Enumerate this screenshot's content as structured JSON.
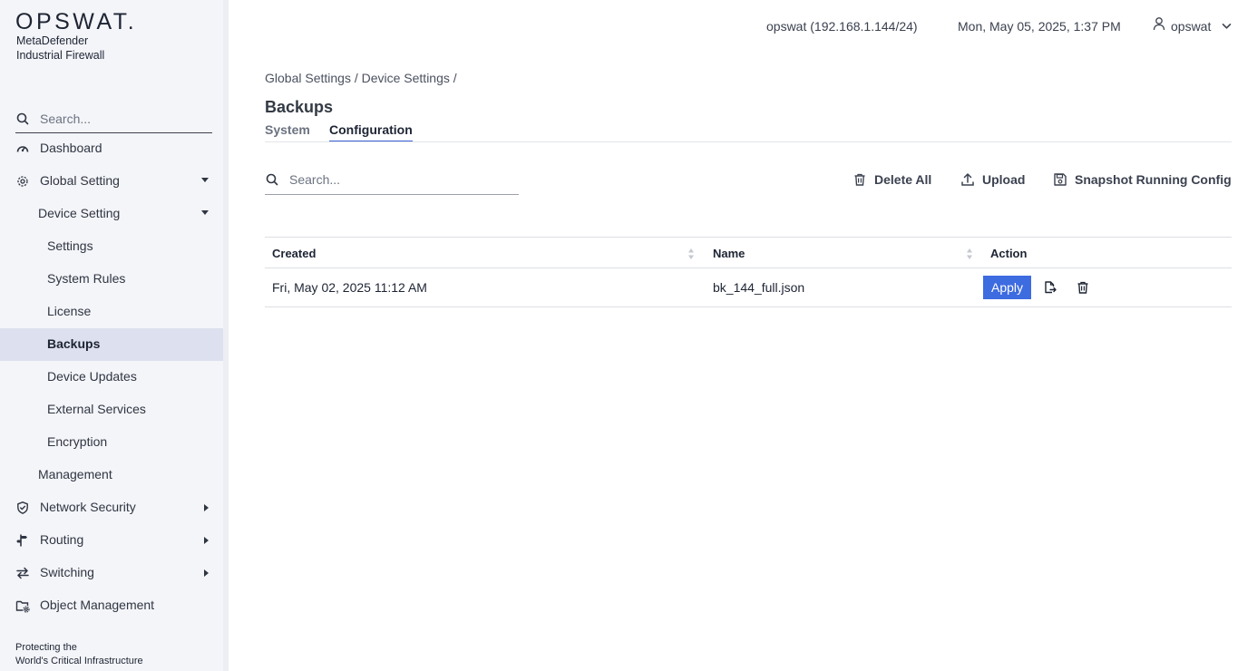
{
  "brand": {
    "logo": "OPSWAT.",
    "product_line1": "MetaDefender",
    "product_line2": "Industrial Firewall"
  },
  "sidebar": {
    "search_placeholder": "Search...",
    "items": [
      {
        "label": "Dashboard",
        "icon": "dashboard-icon"
      },
      {
        "label": "Global Setting",
        "icon": "gear-icon",
        "expanded": true
      },
      {
        "label": "Device Setting",
        "expanded": true
      },
      {
        "label": "Settings"
      },
      {
        "label": "System Rules"
      },
      {
        "label": "License"
      },
      {
        "label": "Backups",
        "active": true
      },
      {
        "label": "Device Updates"
      },
      {
        "label": "External Services"
      },
      {
        "label": "Encryption"
      },
      {
        "label": "Management"
      },
      {
        "label": "Network Security",
        "icon": "shield-icon"
      },
      {
        "label": "Routing",
        "icon": "signpost-icon"
      },
      {
        "label": "Switching",
        "icon": "swap-icon"
      },
      {
        "label": "Object Management",
        "icon": "folder-gear-icon"
      }
    ],
    "footer_line1": "Protecting the",
    "footer_line2": "World's Critical Infrastructure"
  },
  "header": {
    "host": "opswat (192.168.1.144/24)",
    "datetime": "Mon, May 05, 2025, 1:37 PM",
    "user": "opswat"
  },
  "main": {
    "breadcrumb": "Global Settings / Device Settings /",
    "title": "Backups",
    "tabs": [
      {
        "label": "System",
        "active": false
      },
      {
        "label": "Configuration",
        "active": true
      }
    ],
    "search_placeholder": "Search...",
    "toolbar": {
      "delete_all": "Delete All",
      "upload": "Upload",
      "snapshot": "Snapshot Running Config"
    },
    "table": {
      "columns": [
        "Created",
        "Name",
        "Action"
      ],
      "rows": [
        {
          "created": "Fri, May 02, 2025 11:12 AM",
          "name": "bk_144_full.json",
          "apply_label": "Apply"
        }
      ]
    }
  },
  "colors": {
    "accent": "#3d6be0",
    "sidebar_bg": "#f4f5f9",
    "active_item_bg": "#dde0ee"
  }
}
